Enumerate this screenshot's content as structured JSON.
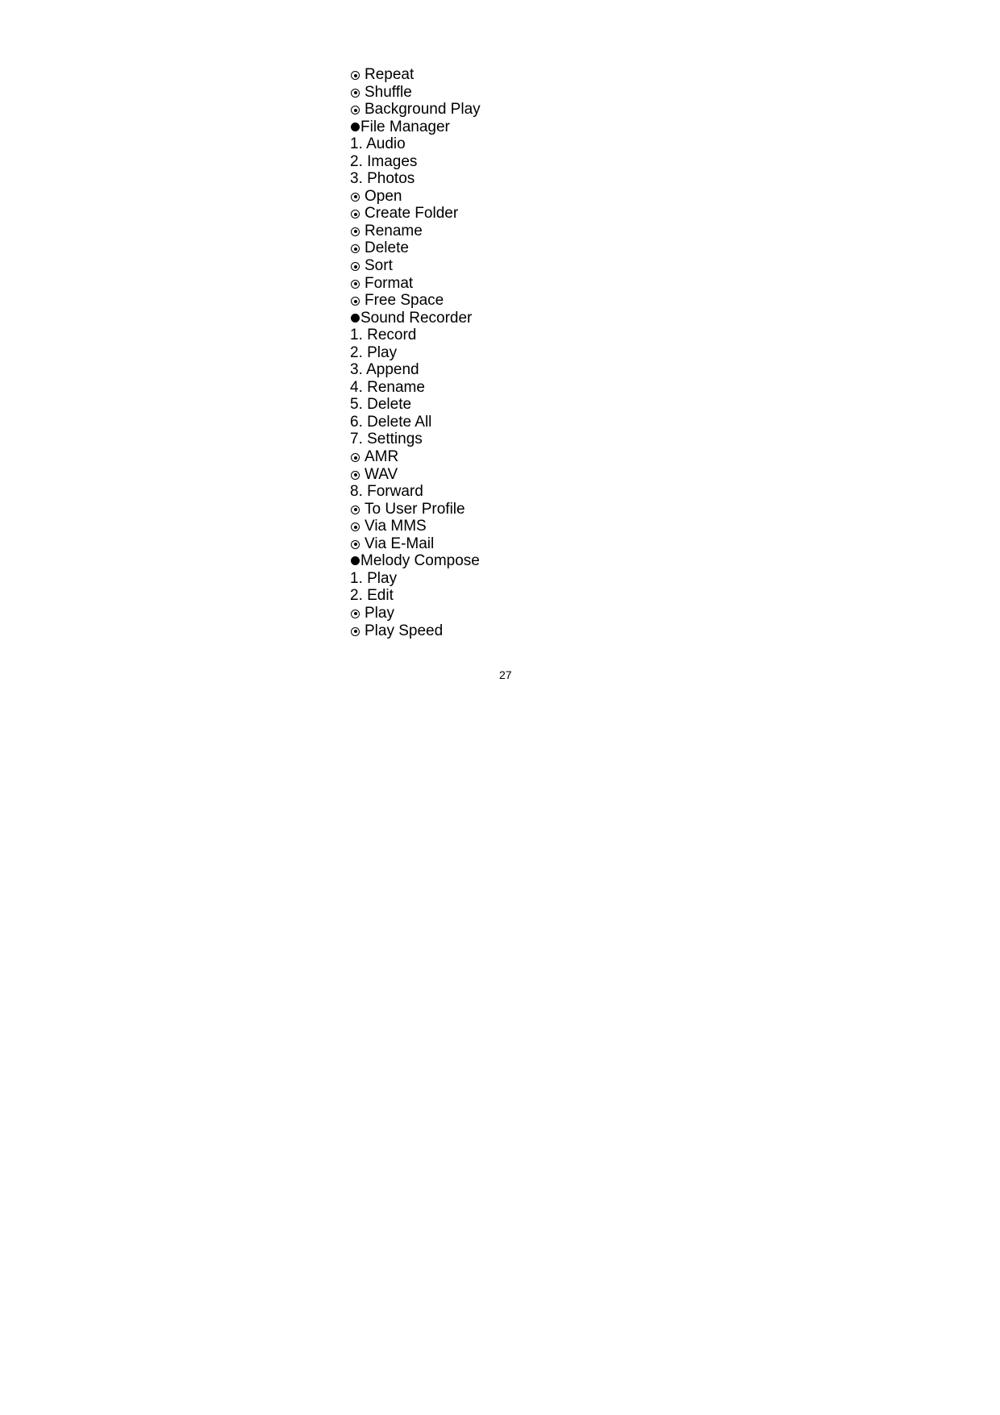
{
  "items": [
    {
      "type": "option",
      "text": "Repeat"
    },
    {
      "type": "option",
      "text": "Shuffle"
    },
    {
      "type": "option",
      "text": "Background Play"
    },
    {
      "type": "section",
      "text": "File Manager"
    },
    {
      "type": "numbered",
      "text": "1. Audio"
    },
    {
      "type": "numbered",
      "text": "2. Images"
    },
    {
      "type": "numbered",
      "text": "3. Photos"
    },
    {
      "type": "option",
      "text": "Open"
    },
    {
      "type": "option",
      "text": "Create Folder"
    },
    {
      "type": "option",
      "text": "Rename"
    },
    {
      "type": "option",
      "text": "Delete"
    },
    {
      "type": "option",
      "text": "Sort"
    },
    {
      "type": "option",
      "text": "Format"
    },
    {
      "type": "option",
      "text": "Free Space"
    },
    {
      "type": "section",
      "text": "Sound Recorder"
    },
    {
      "type": "numbered",
      "text": "1. Record"
    },
    {
      "type": "numbered",
      "text": "2. Play"
    },
    {
      "type": "numbered",
      "text": "3. Append"
    },
    {
      "type": "numbered",
      "text": "4. Rename"
    },
    {
      "type": "numbered",
      "text": "5. Delete"
    },
    {
      "type": "numbered",
      "text": "6. Delete All"
    },
    {
      "type": "numbered",
      "text": "7. Settings"
    },
    {
      "type": "option",
      "text": "AMR"
    },
    {
      "type": "option",
      "text": "WAV"
    },
    {
      "type": "numbered",
      "text": "8. Forward"
    },
    {
      "type": "option",
      "text": "To User Profile"
    },
    {
      "type": "option",
      "text": "Via MMS"
    },
    {
      "type": "option",
      "text": "Via E-Mail"
    },
    {
      "type": "section",
      "text": "Melody Compose"
    },
    {
      "type": "numbered",
      "text": "1. Play"
    },
    {
      "type": "numbered",
      "text": "2. Edit"
    },
    {
      "type": "option",
      "text": "Play"
    },
    {
      "type": "option",
      "text": "Play Speed"
    }
  ],
  "icons": {
    "option": "circled-dot-icon",
    "section": "filled-bullet-icon"
  },
  "page_number": "27"
}
